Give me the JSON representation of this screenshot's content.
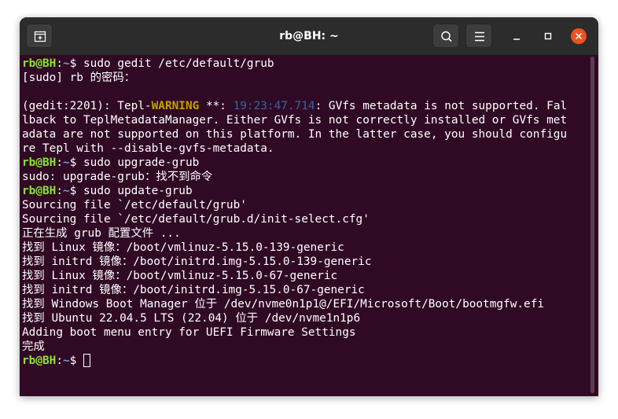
{
  "window": {
    "title": "rb@BH: ~"
  },
  "terminal": {
    "lines": [
      {
        "user": "rb@BH",
        "sep": ":",
        "path": "~",
        "sym": "$ ",
        "cmd": "sudo gedit /etc/default/grub"
      },
      {
        "text": "[sudo] rb 的密码："
      },
      {
        "text": ""
      },
      {
        "a": "(gedit:2201): Tepl-",
        "warn": "WARNING",
        "b": " **: ",
        "time": "19:23:47.714",
        "c": ": GVfs metadata is not supported. Fal"
      },
      {
        "text": "lback to TeplMetadataManager. Either GVfs is not correctly installed or GVfs met"
      },
      {
        "text": "adata are not supported on this platform. In the latter case, you should configu"
      },
      {
        "text": "re Tepl with --disable-gvfs-metadata."
      },
      {
        "user": "rb@BH",
        "sep": ":",
        "path": "~",
        "sym": "$ ",
        "cmd": "sudo upgrade-grub"
      },
      {
        "text": "sudo: upgrade-grub：找不到命令"
      },
      {
        "user": "rb@BH",
        "sep": ":",
        "path": "~",
        "sym": "$ ",
        "cmd": "sudo update-grub"
      },
      {
        "text": "Sourcing file `/etc/default/grub'"
      },
      {
        "text": "Sourcing file `/etc/default/grub.d/init-select.cfg'"
      },
      {
        "text": "正在生成 grub 配置文件 ..."
      },
      {
        "text": "找到 Linux 镜像：/boot/vmlinuz-5.15.0-139-generic"
      },
      {
        "text": "找到 initrd 镜像：/boot/initrd.img-5.15.0-139-generic"
      },
      {
        "text": "找到 Linux 镜像：/boot/vmlinuz-5.15.0-67-generic"
      },
      {
        "text": "找到 initrd 镜像：/boot/initrd.img-5.15.0-67-generic"
      },
      {
        "text": "找到 Windows Boot Manager 位于 /dev/nvme0n1p1@/EFI/Microsoft/Boot/bootmgfw.efi"
      },
      {
        "text": "找到 Ubuntu 22.04.5 LTS (22.04) 位于 /dev/nvme1n1p6"
      },
      {
        "text": "Adding boot menu entry for UEFI Firmware Settings"
      },
      {
        "text": "完成"
      },
      {
        "user": "rb@BH",
        "sep": ":",
        "path": "~",
        "sym": "$ ",
        "cmd": ""
      }
    ]
  },
  "colors": {
    "background": "#300a24",
    "titlebar": "#2c2c2c",
    "prompt_user": "#8ae234",
    "prompt_path": "#729fcf",
    "warning": "#c4a000",
    "timestamp": "#3465a4",
    "close": "#e95420"
  },
  "icons": {
    "new_tab": "new-tab-icon",
    "search": "search-icon",
    "menu": "hamburger-menu-icon",
    "minimize": "minimize-icon",
    "maximize": "maximize-icon",
    "close": "close-icon"
  }
}
